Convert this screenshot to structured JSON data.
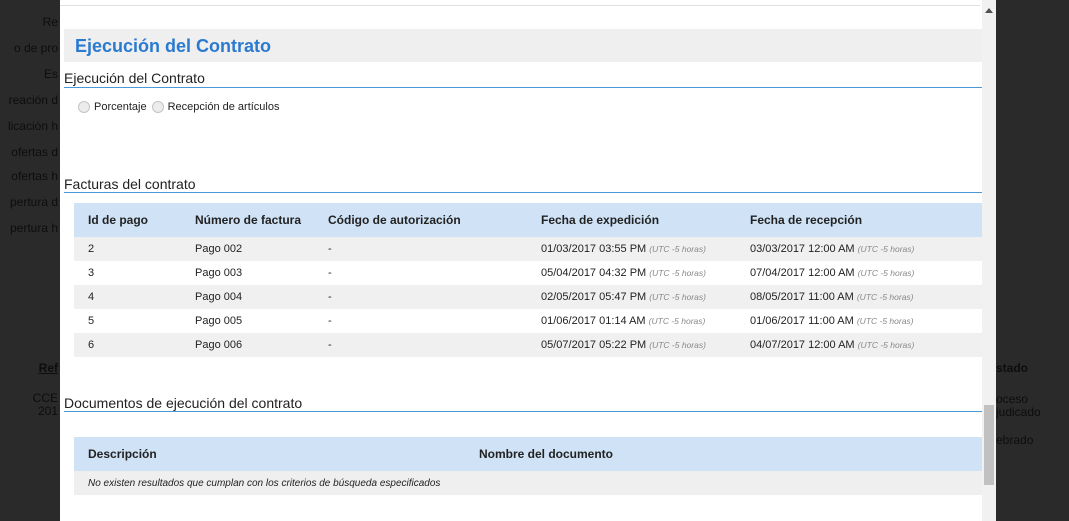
{
  "background_left": [
    "Re",
    "o de pro",
    "Es",
    "reación d",
    "licación h",
    "ofertas d",
    "ofertas h",
    "pertura d",
    "pertura h",
    "Ref",
    "CCE",
    "201"
  ],
  "background_right": [
    "stado",
    "oceso",
    "judicado",
    "ebrado"
  ],
  "page_title": "Ejecución del Contrato",
  "execution": {
    "section_title": "Ejecución del Contrato",
    "options": [
      "Porcentaje",
      "Recepción de artículos"
    ]
  },
  "invoices": {
    "section_title": "Facturas del contrato",
    "columns": [
      "Id de pago",
      "Número de factura",
      "Código de autorización",
      "Fecha de expedición",
      "Fecha de recepción"
    ],
    "tz_note": "(UTC -5 horas)",
    "rows": [
      {
        "id": "2",
        "invoice": "Pago 002",
        "auth": "-",
        "issued": "01/03/2017 03:55 PM",
        "received": "03/03/2017 12:00 AM"
      },
      {
        "id": "3",
        "invoice": "Pago 003",
        "auth": "-",
        "issued": "05/04/2017 04:32 PM",
        "received": "07/04/2017 12:00 AM"
      },
      {
        "id": "4",
        "invoice": "Pago 004",
        "auth": "-",
        "issued": "02/05/2017 05:47 PM",
        "received": "08/05/2017 11:00 AM"
      },
      {
        "id": "5",
        "invoice": "Pago 005",
        "auth": "-",
        "issued": "01/06/2017 01:14 AM",
        "received": "01/06/2017 11:00 AM"
      },
      {
        "id": "6",
        "invoice": "Pago 006",
        "auth": "-",
        "issued": "05/07/2017 05:22 PM",
        "received": "04/07/2017 12:00 AM"
      }
    ]
  },
  "documents": {
    "section_title": "Documentos de ejecución del contrato",
    "columns": [
      "Descripción",
      "Nombre del documento"
    ],
    "empty_message": "No existen resultados que cumplan con los criterios de búsqueda especificados"
  },
  "colors": {
    "title": "#2a7ad0",
    "header_bg": "#cfe2f6",
    "section_line": "#4a98d8"
  }
}
